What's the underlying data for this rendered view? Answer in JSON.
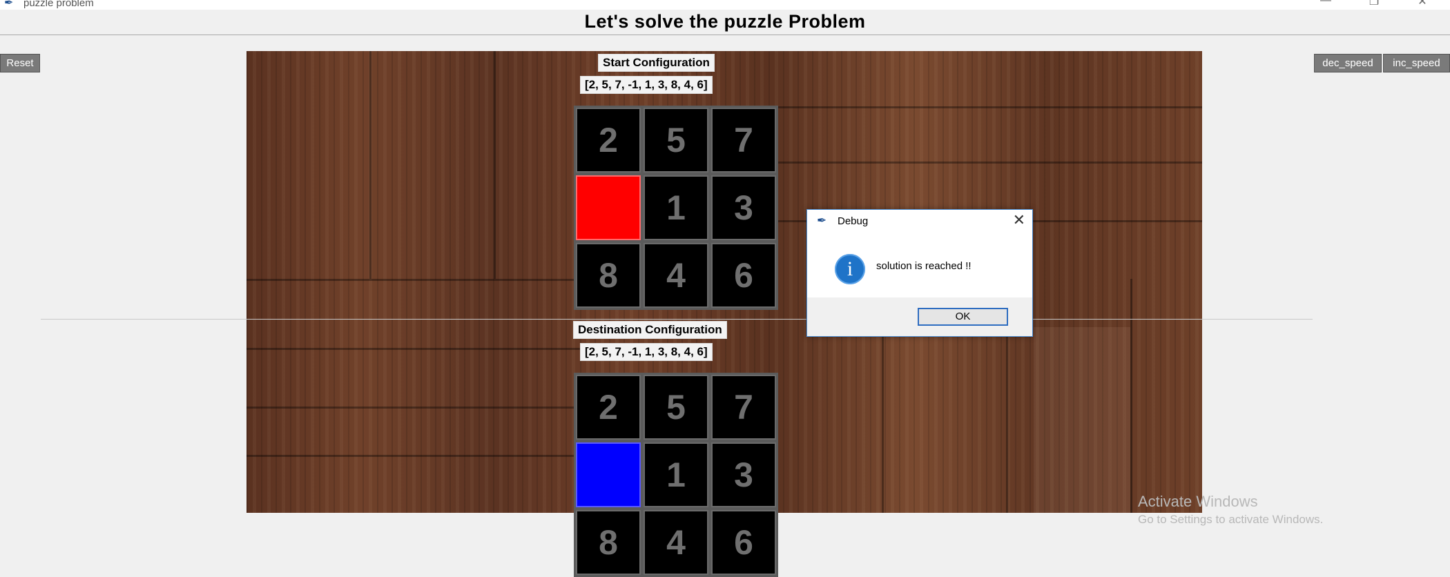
{
  "window": {
    "title": "puzzle problem",
    "controls": {
      "minimize": "—",
      "maximize": "❐",
      "close": "✕"
    }
  },
  "header": {
    "title": "Let's solve the puzzle Problem"
  },
  "buttons": {
    "reset": "Reset",
    "dec_speed": "dec_speed",
    "inc_speed": "inc_speed"
  },
  "start": {
    "label": "Start Configuration",
    "state_text": "[2, 5, 7, -1, 1, 3, 8, 4, 6]",
    "tiles": [
      "2",
      "5",
      "7",
      "",
      "1",
      "3",
      "8",
      "4",
      "6"
    ],
    "blank_color": "#ff0000"
  },
  "destination": {
    "label": "Destination Configuration",
    "state_text": "[2, 5, 7, -1, 1, 3, 8, 4, 6]",
    "tiles": [
      "2",
      "5",
      "7",
      "",
      "1",
      "3",
      "8",
      "4",
      "6"
    ],
    "blank_color": "#0000ff"
  },
  "dialog": {
    "title": "Debug",
    "message": "solution is reached !!",
    "ok_label": "OK",
    "icon": "i"
  },
  "watermark": {
    "title": "Activate Windows",
    "subtitle": "Go to Settings to activate Windows."
  }
}
